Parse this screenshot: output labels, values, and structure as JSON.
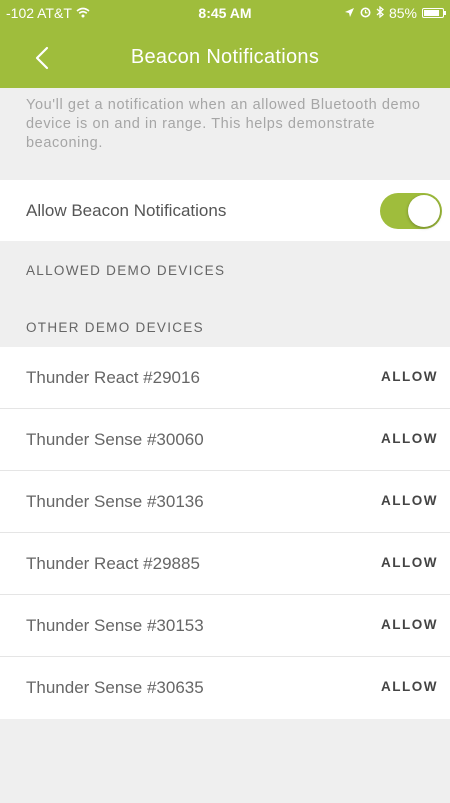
{
  "status_bar": {
    "carrier": "-102 AT&T",
    "time": "8:45 AM",
    "battery": "85%",
    "battery_level": 0.85,
    "icons": [
      "wifi-icon",
      "location-arrow-icon",
      "alarm-icon",
      "bluetooth-icon",
      "battery-icon"
    ]
  },
  "nav": {
    "title": "Beacon Notifications",
    "back_icon": "chevron-left-icon"
  },
  "info_text": "You'll get a notification when an allowed Bluetooth demo device is on and in range. This helps demonstrate beaconing.",
  "toggle": {
    "label": "Allow Beacon Notifications",
    "on": true
  },
  "sections": {
    "allowed_header": "ALLOWED DEMO DEVICES",
    "other_header": "OTHER DEMO DEVICES"
  },
  "devices": [
    {
      "name": "Thunder React #29016",
      "action": "ALLOW"
    },
    {
      "name": "Thunder Sense #30060",
      "action": "ALLOW"
    },
    {
      "name": "Thunder Sense #30136",
      "action": "ALLOW"
    },
    {
      "name": "Thunder React #29885",
      "action": "ALLOW"
    },
    {
      "name": "Thunder Sense #30153",
      "action": "ALLOW"
    },
    {
      "name": "Thunder Sense #30635",
      "action": "ALLOW"
    }
  ],
  "colors": {
    "accent": "#9fbd3c",
    "background": "#efefef",
    "info_text": "#a6a6a6"
  }
}
